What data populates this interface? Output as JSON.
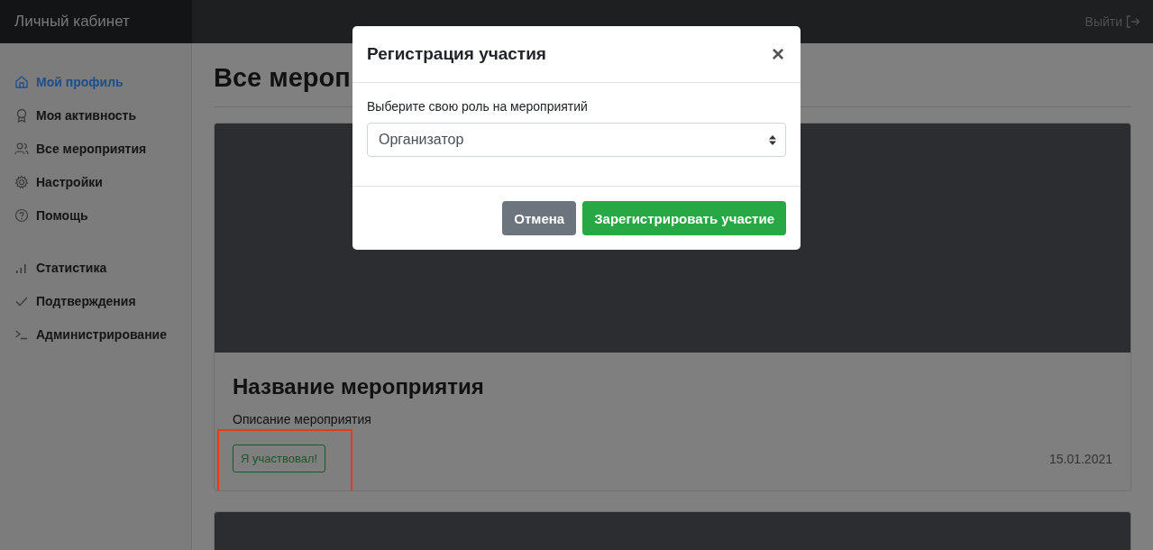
{
  "header": {
    "brand": "Личный кабинет",
    "logout": "Выйти"
  },
  "sidebar": {
    "groups": [
      {
        "items": [
          {
            "label": "Мой профиль",
            "kind": "home",
            "selected": true
          },
          {
            "label": "Моя активность",
            "kind": "award",
            "selected": false
          },
          {
            "label": "Все мероприятия",
            "kind": "people",
            "selected": false
          },
          {
            "label": "Настройки",
            "kind": "gear",
            "selected": false
          },
          {
            "label": "Помощь",
            "kind": "help",
            "selected": false
          }
        ]
      },
      {
        "items": [
          {
            "label": "Статистика",
            "kind": "chart",
            "selected": false
          },
          {
            "label": "Подтверждения",
            "kind": "check",
            "selected": false
          },
          {
            "label": "Администрирование",
            "kind": "terminal",
            "selected": false
          }
        ]
      }
    ]
  },
  "main": {
    "heading": "Все мероп",
    "cards": [
      {
        "kind": "event",
        "title": "Название мероприятия",
        "description": "Описание мероприятия",
        "button": "Я участвовал!",
        "date": "15.01.2021",
        "highlighted": true
      },
      {
        "kind": "cover"
      }
    ]
  },
  "modal": {
    "title": "Регистрация участия",
    "close": "×",
    "field_label": "Выберите свою роль на мероприятий",
    "select": {
      "value": "Организатор"
    },
    "buttons": [
      {
        "label": "Отмена",
        "kind": "secondary"
      },
      {
        "label": "Зарегистрировать участие",
        "kind": "success"
      }
    ]
  }
}
